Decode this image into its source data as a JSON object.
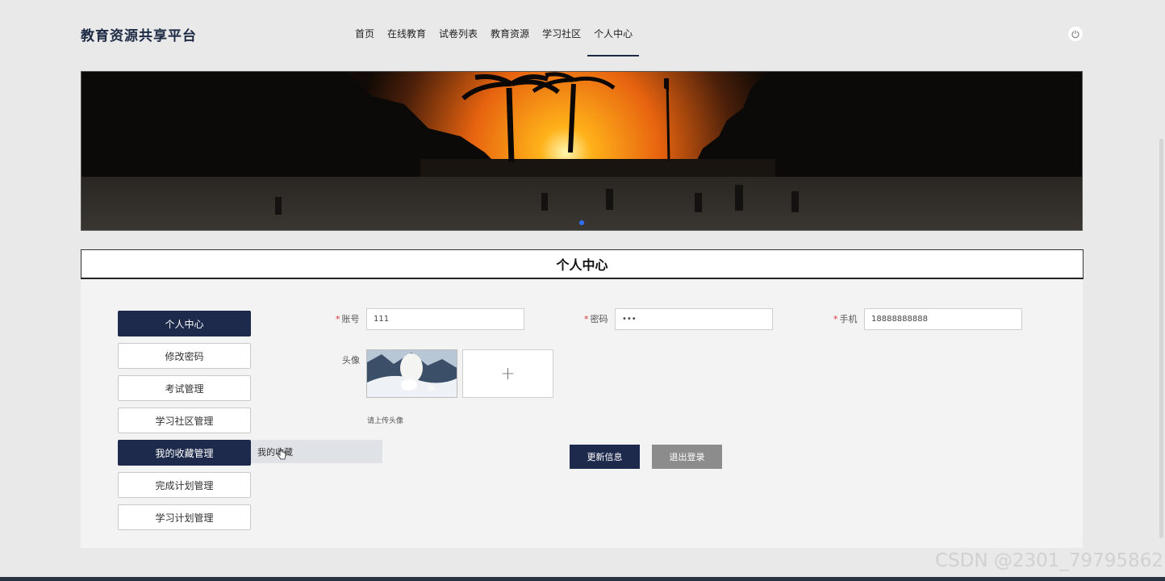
{
  "brand": "教育资源共享平台",
  "nav": [
    "首页",
    "在线教育",
    "试卷列表",
    "教育资源",
    "学习社区",
    "个人中心"
  ],
  "section_title": "个人中心",
  "menu": [
    "个人中心",
    "修改密码",
    "考试管理",
    "学习社区管理",
    "我的收藏管理",
    "完成计划管理",
    "学习计划管理"
  ],
  "submenu": "我的收藏",
  "form": {
    "account_label": "账号",
    "account_value": "111",
    "password_label": "密码",
    "password_value": "•••",
    "phone_label": "手机",
    "phone_value": "18888888888",
    "avatar_label": "头像",
    "upload_hint": "请上传头像",
    "required_mark": "*",
    "upload_plus": "+"
  },
  "buttons": {
    "update": "更新信息",
    "logout": "退出登录"
  },
  "watermark": "CSDN @2301_79795862",
  "colors": {
    "primary": "#1d2a4b",
    "secondary": "#8c8c8c",
    "required": "#e03131"
  }
}
